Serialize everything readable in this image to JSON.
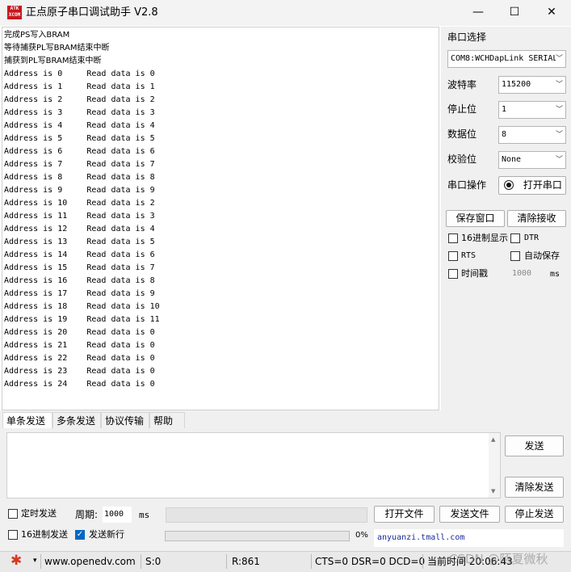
{
  "window": {
    "title": "正点原子串口调试助手 V2.8",
    "logo_text": "ATK\nXCOM",
    "logo_color": "#c8161d",
    "minimize": "—",
    "maximize": "☐",
    "close": "✕"
  },
  "receive": {
    "lines": [
      "完成PS写入BRAM",
      "等待捕获PL写BRAM结束中断",
      "捕获到PL写BRAM结束中断",
      "Address is 0     Read data is 0",
      "Address is 1     Read data is 1",
      "Address is 2     Read data is 2",
      "Address is 3     Read data is 3",
      "Address is 4     Read data is 4",
      "Address is 5     Read data is 5",
      "Address is 6     Read data is 6",
      "Address is 7     Read data is 7",
      "Address is 8     Read data is 8",
      "Address is 9     Read data is 9",
      "Address is 10    Read data is 2",
      "Address is 11    Read data is 3",
      "Address is 12    Read data is 4",
      "Address is 13    Read data is 5",
      "Address is 14    Read data is 6",
      "Address is 15    Read data is 7",
      "Address is 16    Read data is 8",
      "Address is 17    Read data is 9",
      "Address is 18    Read data is 10",
      "Address is 19    Read data is 11",
      "Address is 20    Read data is 0",
      "Address is 21    Read data is 0",
      "Address is 22    Read data is 0",
      "Address is 23    Read data is 0",
      "Address is 24    Read data is 0"
    ]
  },
  "settings": {
    "port_label": "串口选择",
    "port_value": "COM8:WCHDapLink SERIAL",
    "baud_label": "波特率",
    "baud_value": "115200",
    "stop_label": "停止位",
    "stop_value": "1",
    "data_label": "数据位",
    "data_value": "8",
    "parity_label": "校验位",
    "parity_value": "None",
    "op_label": "串口操作",
    "open_button": "打开串口",
    "chevron": "﹀"
  },
  "receive_options": {
    "save_window": "保存窗口",
    "clear_receive": "清除接收",
    "hex_display": "16进制显示",
    "dtr": "DTR",
    "rts": "RTS",
    "auto_save": "自动保存",
    "timestamp": "时间戳",
    "timestamp_value": "1000",
    "timestamp_unit": "ms"
  },
  "tabs": [
    "单条发送",
    "多条发送",
    "协议传输",
    "帮助"
  ],
  "send": {
    "send_button": "发送",
    "clear_send": "清除发送",
    "timed_send": "定时发送",
    "period_label": "周期:",
    "period_value": "1000",
    "period_unit": "ms",
    "open_file": "打开文件",
    "send_file": "发送文件",
    "stop_send": "停止发送",
    "hex_send": "16进制发送",
    "send_newline": "发送新行",
    "newline_checked": true,
    "progress_percent": 0,
    "progress_text": "0%",
    "link": "anyuanzi.tmall.com"
  },
  "status": {
    "gear_color": "#d9371f",
    "gear": "✱",
    "dropdown": "▾",
    "website": "www.openedv.com",
    "sent": "S:0",
    "received": "R:861",
    "lines": "CTS=0 DSR=0 DCD=0",
    "time": "当前时间 20:06:43",
    "watermark": "CSDN @陌夏微秋"
  }
}
